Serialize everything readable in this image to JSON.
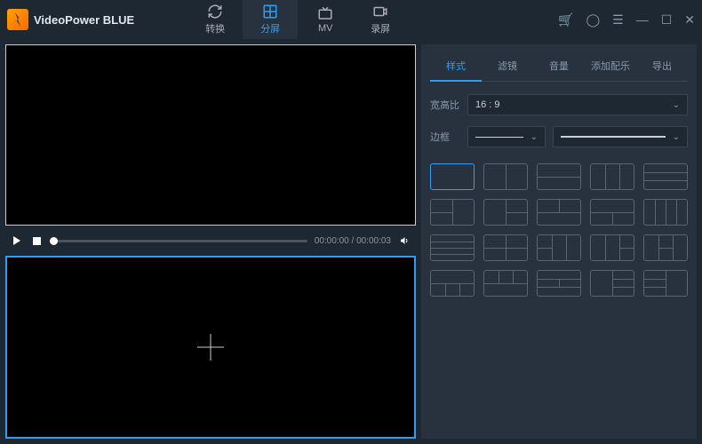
{
  "app": {
    "name": "VideoPower BLUE"
  },
  "tabs": [
    {
      "label": "转换",
      "active": false
    },
    {
      "label": "分屏",
      "active": true
    },
    {
      "label": "MV",
      "active": false
    },
    {
      "label": "录屏",
      "active": false
    }
  ],
  "player": {
    "current_time": "00:00:00",
    "total_time": "00:00:03"
  },
  "panel": {
    "tabs": [
      "样式",
      "滤镜",
      "音量",
      "添加配乐",
      "导出"
    ],
    "active_tab": 0,
    "aspect_label": "宽高比",
    "aspect_value": "16 : 9",
    "border_label": "边框"
  },
  "layouts_count": 20,
  "selected_layout": 0
}
